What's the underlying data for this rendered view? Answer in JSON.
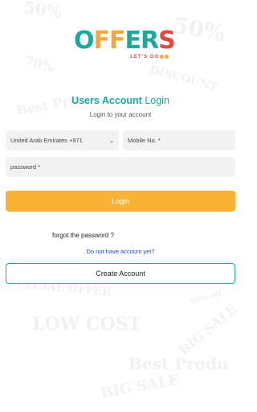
{
  "logo": {
    "word": "OFFERS",
    "tagline": "LET'S GO"
  },
  "header": {
    "title_bold": "Users Account",
    "title_rest": " Login",
    "subtitle": "Login to your account"
  },
  "form": {
    "country_value": "United Arab Emirates +971",
    "mobile_placeholder": "Mobile No. *",
    "password_placeholder": "password *",
    "login_label": "Login"
  },
  "links": {
    "forgot_password": "forgot the password ?",
    "no_account": "Do not have account yet?"
  },
  "create_account_label": "Create Account",
  "background_words": [
    "50%",
    "70%",
    "Best Price",
    "LOW COST",
    "BIG SALE",
    "Best Produ",
    "SPECIAL OFFER",
    "BIG SALE",
    "40% off",
    "DISCOUNT"
  ],
  "colors": {
    "brand_teal": "#1aa99b",
    "brand_orange": "#f9b233",
    "brand_red": "#e8473e",
    "link_blue": "#1a4fb5"
  }
}
